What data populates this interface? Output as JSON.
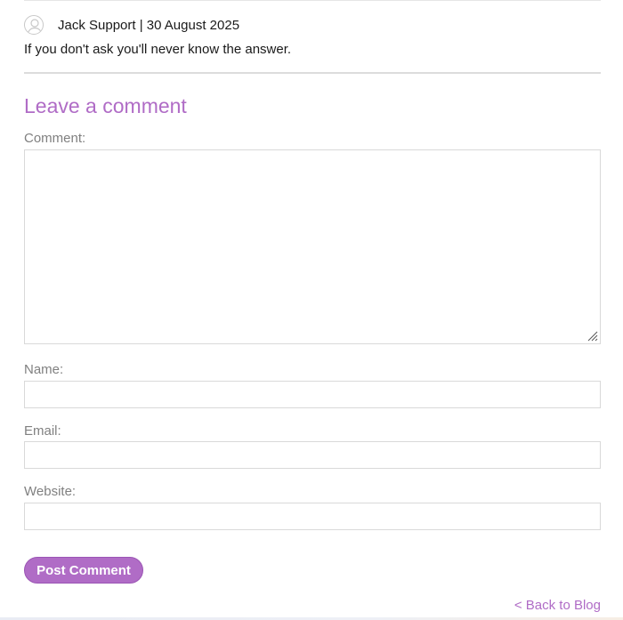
{
  "comment": {
    "author": "Jack Support",
    "separator": "|",
    "date": "30 August 2025",
    "meta": "Jack Support | 30 August 2025",
    "text": "If you don't ask you'll never know the answer.",
    "avatar_icon": "user-avatar-icon"
  },
  "form": {
    "title": "Leave a comment",
    "comment_label": "Comment:",
    "comment_value": "",
    "name_label": "Name:",
    "name_value": "",
    "email_label": "Email:",
    "email_value": "",
    "website_label": "Website:",
    "website_value": "",
    "submit_label": "Post Comment"
  },
  "nav": {
    "back_label": "< Back to Blog"
  },
  "colors": {
    "accent": "#b06cc6",
    "label": "#808080",
    "text": "#1a1a1a",
    "border": "#d9d9d9"
  }
}
